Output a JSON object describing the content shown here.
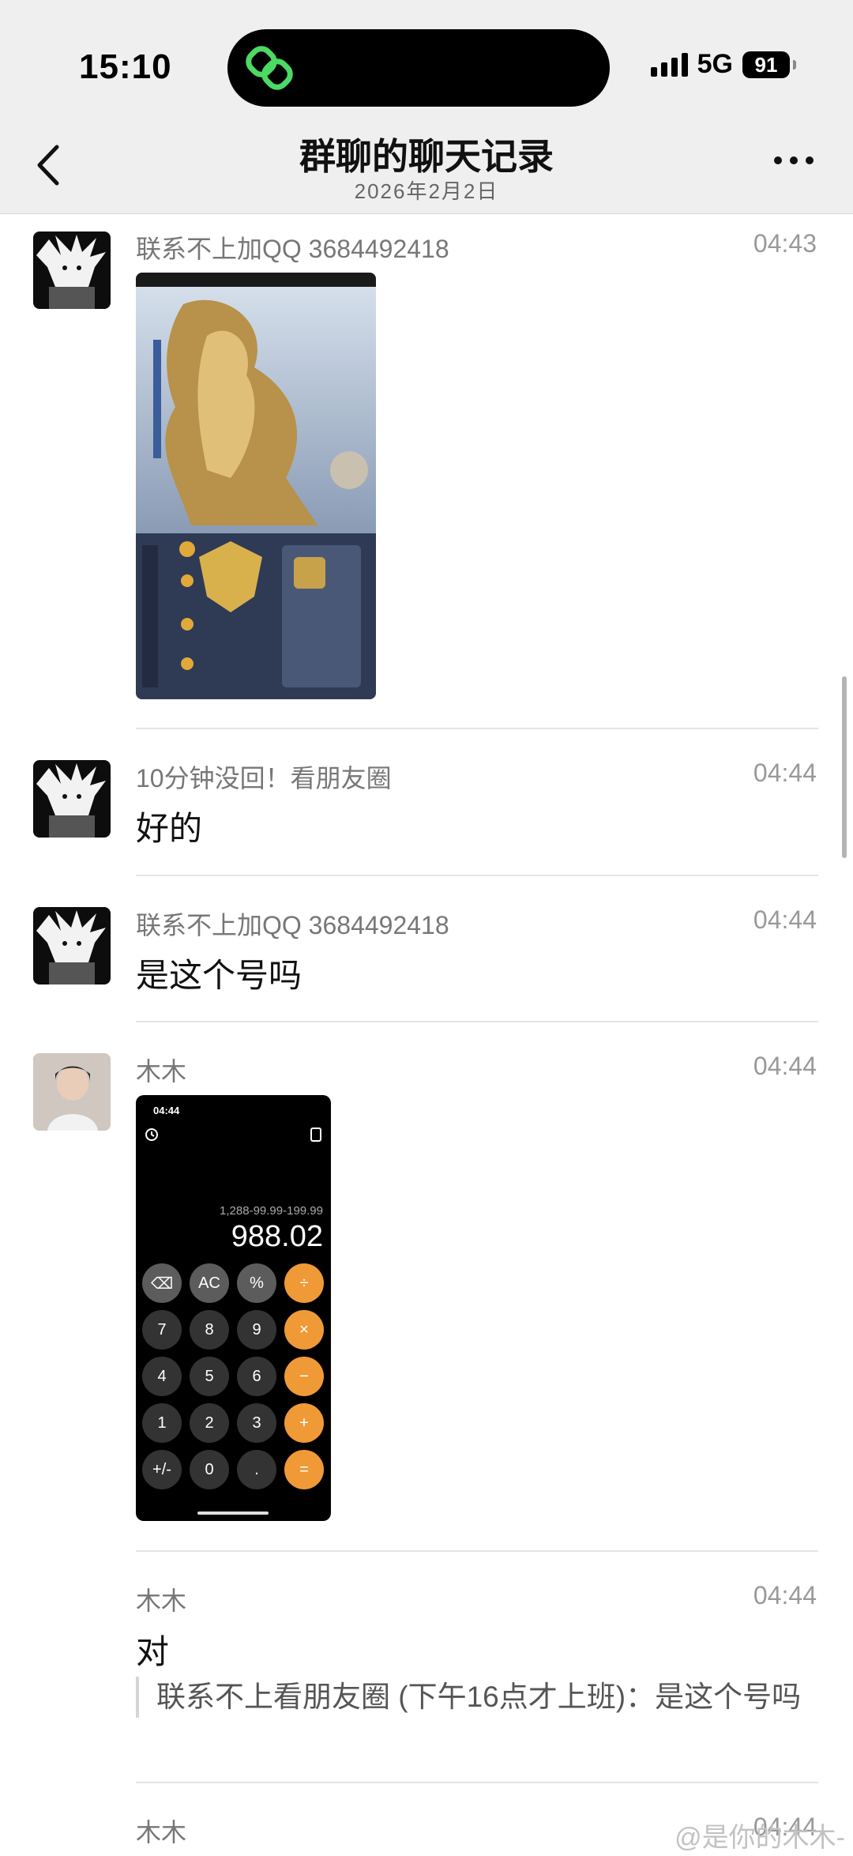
{
  "status_bar": {
    "time": "15:10",
    "network": "5G",
    "battery": "91"
  },
  "header": {
    "title": "群聊的聊天记录",
    "date": "2026年2月2日"
  },
  "messages": [
    {
      "sender": "联系不上加QQ 3684492418",
      "time": "04:43",
      "type": "image",
      "avatar": "anime-avatar"
    },
    {
      "sender": "10分钟没回！看朋友圈",
      "time": "04:44",
      "text": "好的",
      "avatar": "anime-avatar"
    },
    {
      "sender": "联系不上加QQ 3684492418",
      "time": "04:44",
      "text": "是这个号吗",
      "avatar": "anime-avatar"
    },
    {
      "sender": "木木",
      "time": "04:44",
      "type": "image",
      "avatar": "photo-avatar"
    },
    {
      "sender": "木木",
      "time": "04:44",
      "text": "对",
      "quote": "联系不上看朋友圈 (下午16点才上班)：是这个号吗"
    },
    {
      "sender": "木木",
      "time": "04:44"
    }
  ],
  "calculator": {
    "time": "04:44",
    "expression": "1,288-99.99-199.99",
    "result": "988.02",
    "keys": [
      "⌫",
      "AC",
      "%",
      "÷",
      "7",
      "8",
      "9",
      "×",
      "4",
      "5",
      "6",
      "−",
      "1",
      "2",
      "3",
      "+",
      "+/-",
      "0",
      ".",
      "="
    ]
  },
  "watermark": "@是你的木木-",
  "colors": {
    "calc_orange": "#f09a37",
    "calc_gray": "#333333",
    "calc_lightgray": "#a5a5a5"
  }
}
